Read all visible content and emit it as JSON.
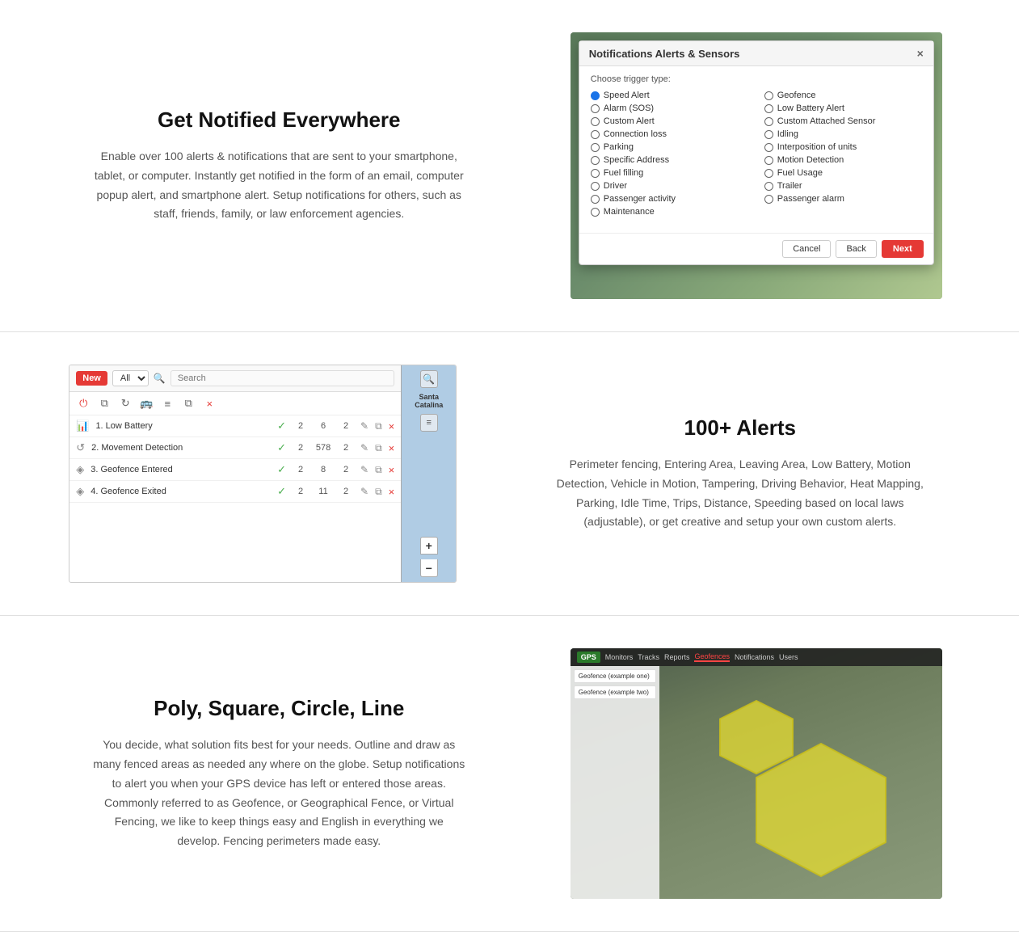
{
  "section1": {
    "title": "Get Notified Everywhere",
    "description": "Enable over 100 alerts & notifications that are sent to your smartphone, tablet, or computer. Instantly get notified in the form of an email, computer popup alert, and smartphone alert. Setup notifications for others, such as staff, friends, family, or law enforcement agencies.",
    "dialog": {
      "title": "Notifications Alerts & Sensors",
      "trigger_label": "Choose trigger type:",
      "options_left": [
        "Speed Alert",
        "Alarm (SOS)",
        "Custom Alert",
        "Connection loss",
        "Parking",
        "Specific Address",
        "Fuel filling",
        "Driver",
        "Passenger activity",
        "Maintenance"
      ],
      "options_right": [
        "Geofence",
        "Low Battery Alert",
        "Custom Attached Sensor",
        "Idling",
        "Interposition of units",
        "Motion Detection",
        "Fuel Usage",
        "Trailer",
        "Passenger alarm"
      ],
      "selected": "Speed Alert",
      "buttons": {
        "cancel": "Cancel",
        "back": "Back",
        "next": "Next"
      }
    }
  },
  "section2": {
    "title": "100+ Alerts",
    "description": "Perimeter fencing, Entering Area, Leaving Area, Low Battery, Motion Detection, Vehicle in Motion, Tampering, Driving Behavior, Heat Mapping, Parking, Idle Time, Trips, Distance, Speeding based on local laws (adjustable), or get creative and setup your own custom alerts.",
    "list": {
      "new_btn": "New",
      "select_placeholder": "All",
      "search_placeholder": "Search",
      "rows": [
        {
          "id": 1,
          "name": "1. Low Battery",
          "checked": true,
          "num1": 2,
          "num2": 6,
          "num3": 2
        },
        {
          "id": 2,
          "name": "2. Movement Detection",
          "checked": true,
          "num1": 2,
          "num2": 578,
          "num3": 2
        },
        {
          "id": 3,
          "name": "3. Geofence Entered",
          "checked": true,
          "num1": 2,
          "num2": 8,
          "num3": 2
        },
        {
          "id": 4,
          "name": "4. Geofence Exited",
          "checked": true,
          "num1": 2,
          "num2": 11,
          "num3": 2
        }
      ]
    }
  },
  "section3": {
    "title": "Poly, Square, Circle, Line",
    "description": "You decide, what solution fits best for your needs. Outline and draw as many fenced areas as needed any where on the globe. Setup notifications to alert you when your GPS device has left or entered those areas. Commonly referred to as Geofence, or Geographical Fence, or Virtual Fencing, we like to keep things easy and English in everything we develop. Fencing perimeters made easy.",
    "map": {
      "logo": "GPS",
      "tabs": [
        "Monitors",
        "Tracks",
        "Reports",
        "Geofences",
        "Notifications",
        "Users"
      ],
      "active_tab": "Geofences",
      "sidebar_items": [
        "Geofence (example one)",
        "Geofence (example two)"
      ]
    }
  },
  "icons": {
    "radio_empty": "○",
    "radio_filled": "●",
    "close": "×",
    "check": "✓",
    "copy": "⧉",
    "delete": "×",
    "edit": "✎",
    "search": "🔍",
    "power": "⏻",
    "refresh": "↻",
    "layers": "≡",
    "zoom_in": "+",
    "zoom_out": "−",
    "battery": "🔋",
    "movement": "↺",
    "geofence": "◈"
  }
}
